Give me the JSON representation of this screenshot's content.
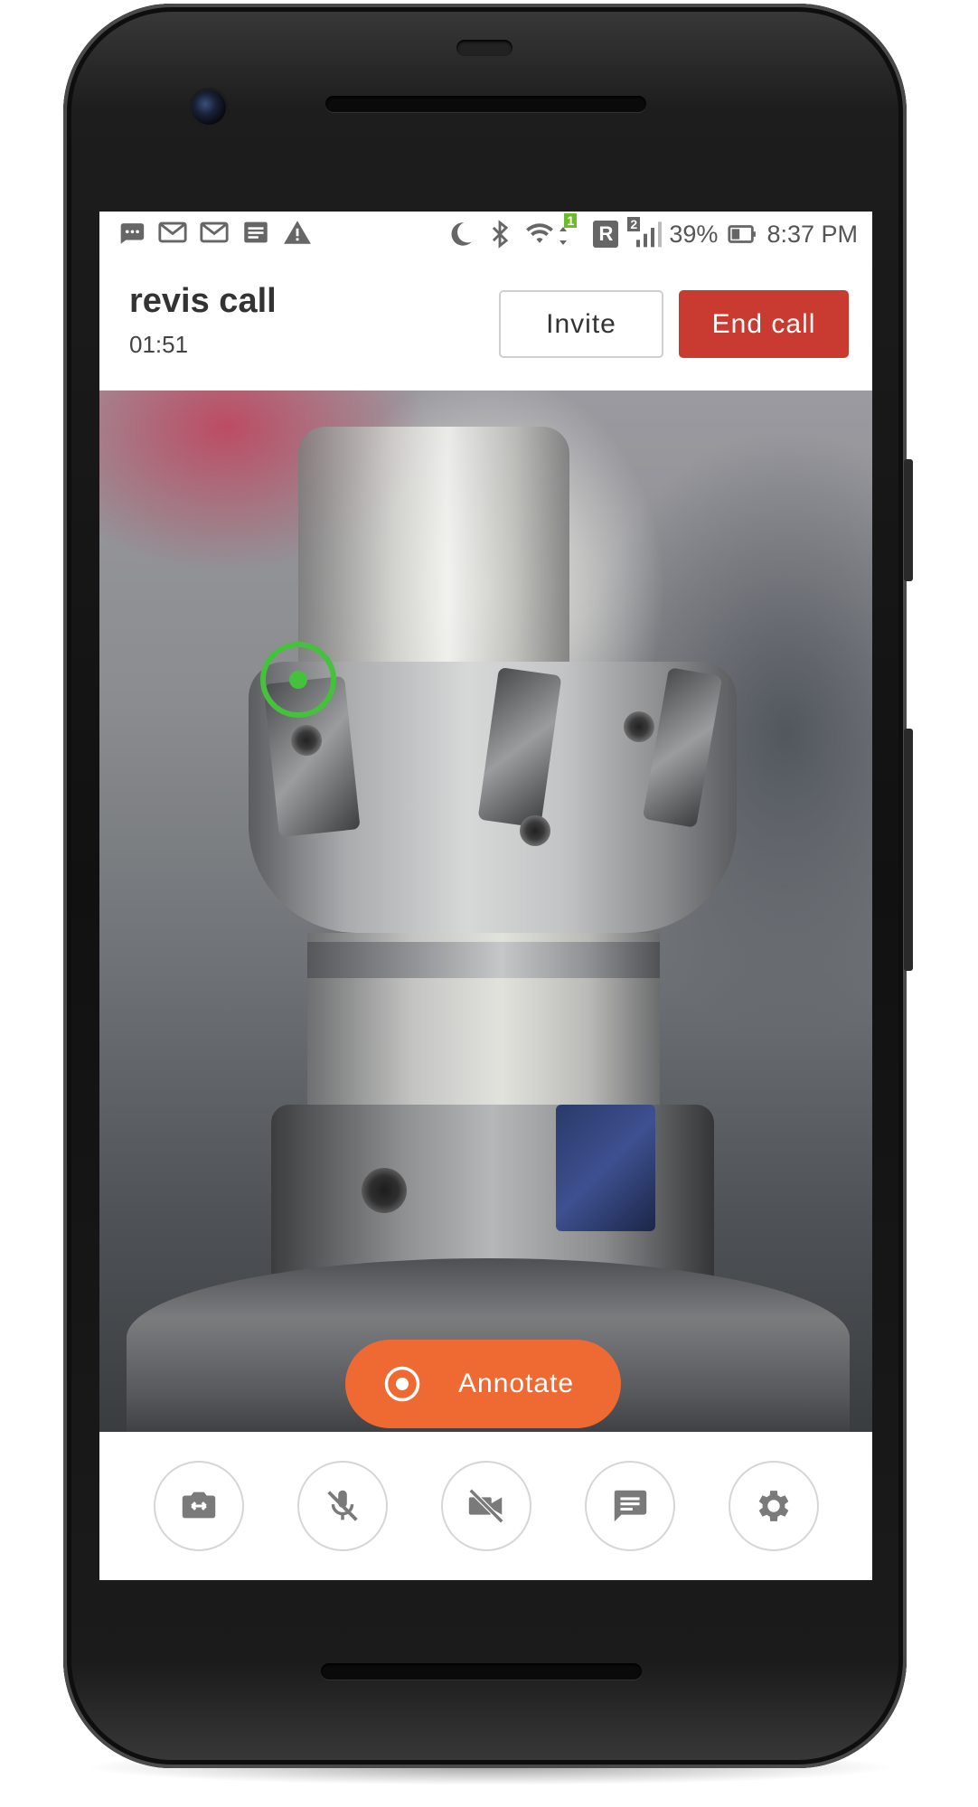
{
  "status_bar": {
    "battery": "39%",
    "time": "8:37 PM",
    "roaming_label": "R",
    "sim_slot": "2",
    "data_badge": "1",
    "icons_left": [
      "sms-icon",
      "gmail-icon",
      "gmail-icon",
      "news-icon",
      "warning-icon"
    ],
    "icons_right": [
      "moon-icon",
      "bluetooth-icon",
      "wifi-icon",
      "roaming-icon",
      "signal-icon",
      "battery-icon"
    ]
  },
  "call": {
    "title": "revis call",
    "timer": "01:51",
    "invite_label": "Invite",
    "end_label": "End call"
  },
  "video": {
    "pointer_color": "#45c23b"
  },
  "annotate": {
    "label": "Annotate",
    "color": "#ee6a32"
  },
  "controls": [
    {
      "name": "switch-camera",
      "icon": "switch-camera-icon"
    },
    {
      "name": "mute-microphone",
      "icon": "mic-off-icon"
    },
    {
      "name": "video-off",
      "icon": "videocam-off-icon"
    },
    {
      "name": "chat",
      "icon": "chat-icon"
    },
    {
      "name": "settings",
      "icon": "gear-icon"
    }
  ],
  "colors": {
    "end_call": "#c93a31",
    "icon_gray": "#7a7a7a"
  }
}
